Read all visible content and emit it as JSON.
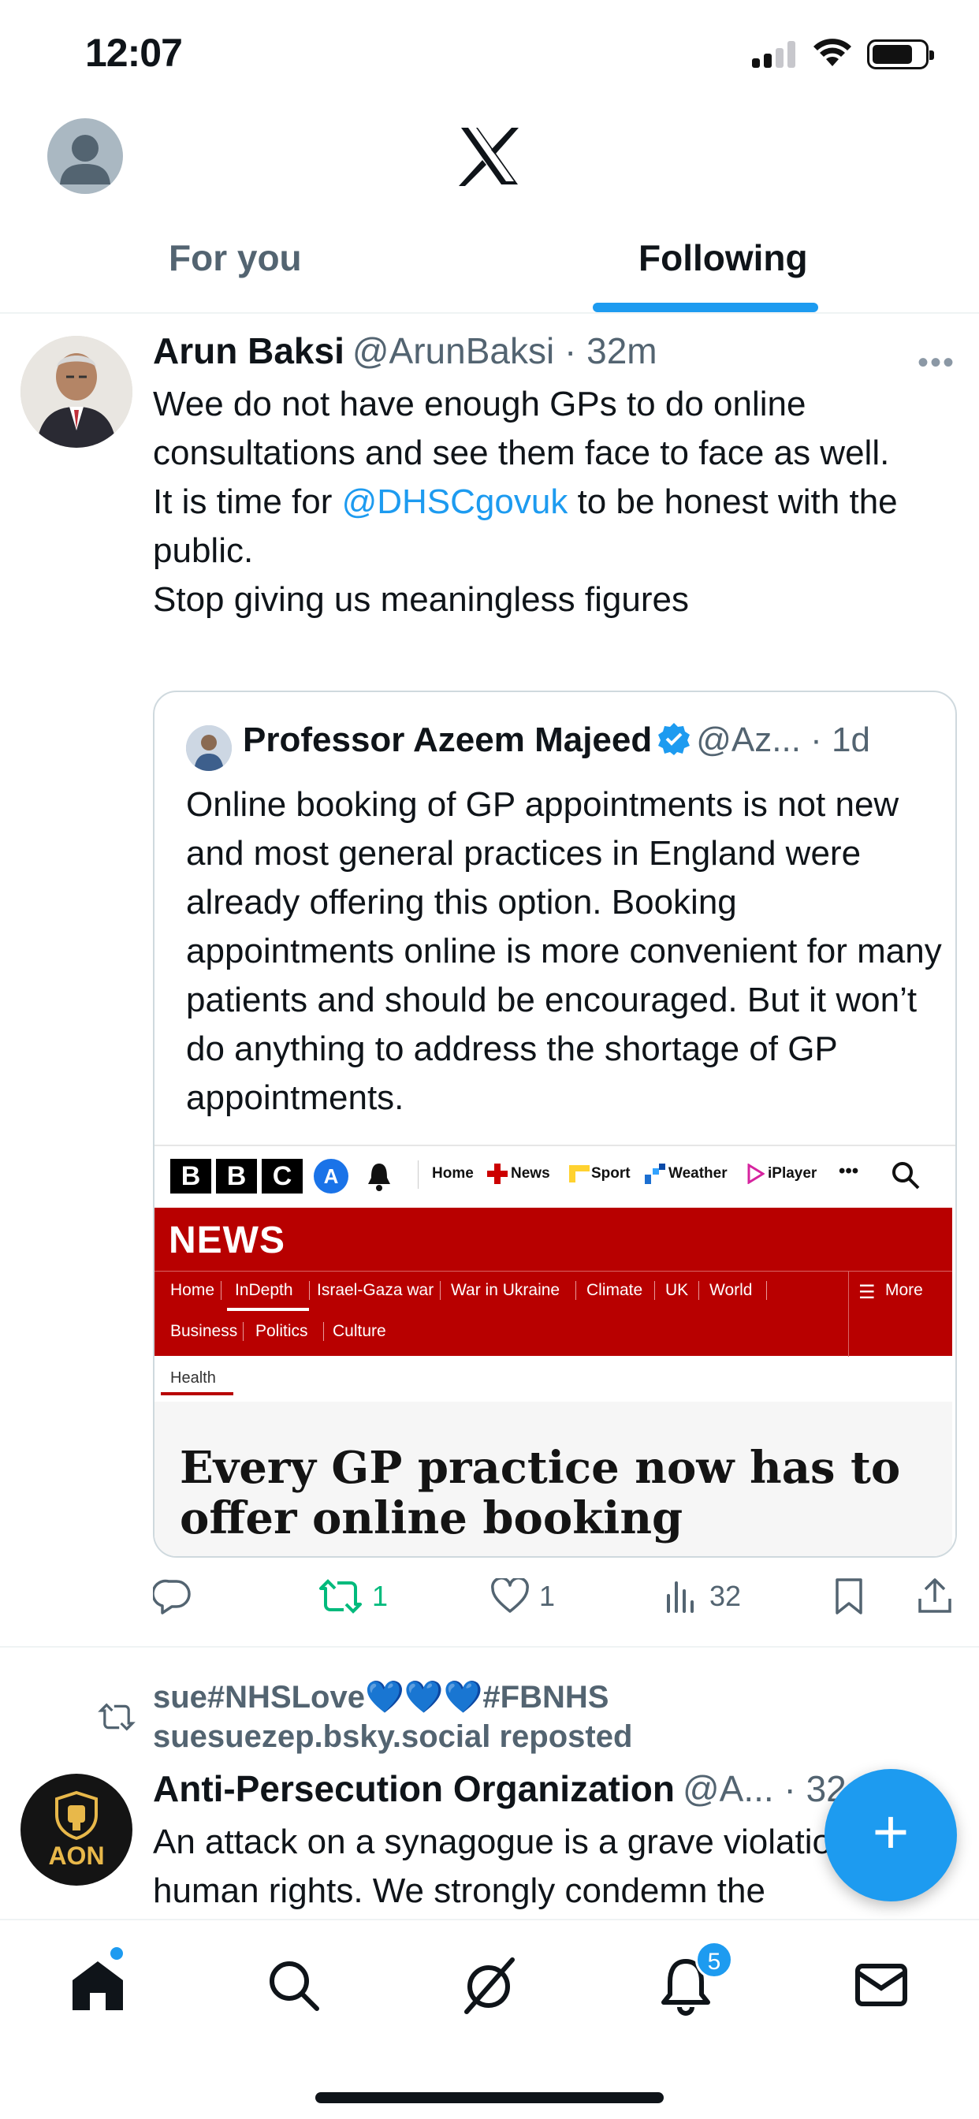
{
  "status_bar": {
    "time": "12:07"
  },
  "header": {
    "tabs": [
      {
        "label": "For you",
        "active": false
      },
      {
        "label": "Following",
        "active": true
      }
    ]
  },
  "tweet": {
    "author_name": "Arun Baksi",
    "handle": "@ArunBaksi",
    "time": "32m",
    "body": {
      "line1": "Wee do not have enough GPs to do online consultations and see them face to face as well.",
      "line2_pre": "It is time for ",
      "line2_mention": "@DHSCgovuk",
      "line2_post": " to be honest with the public.",
      "line3": "Stop giving us meaningless figures"
    },
    "quote": {
      "author_name": "Professor Azeem Majeed",
      "handle": "@Az...",
      "time": "1d",
      "body": "Online booking of GP appointments is not new and most general practices in England were already offering this option. Booking appointments online is more convenient for many patients and should be encouraged. But it won’t do anything to address the shortage of GP appointments.",
      "embed": {
        "logo_letters": [
          "B",
          "B",
          "C"
        ],
        "account_letter": "A",
        "top_nav": [
          "Home",
          "News",
          "Sport",
          "Weather",
          "iPlayer"
        ],
        "more_dots": "•••",
        "news_label": "NEWS",
        "sub_nav": [
          "Home",
          "InDepth",
          "Israel-Gaza war",
          "War in Ukraine",
          "Climate",
          "UK",
          "World",
          "Business",
          "Politics",
          "Culture"
        ],
        "more_label": "More",
        "section": "Health",
        "headline": "Every GP practice now has to offer online booking"
      }
    },
    "actions": {
      "replies": "",
      "reposts": "1",
      "likes": "1",
      "views": "32"
    }
  },
  "tweet2": {
    "reposted_by_name": "sue#NHSLove",
    "reposted_hearts": "💙💙💙",
    "reposted_by_tag": "#FBNHS",
    "reposted_line": "suesuezep.bsky.social reposted",
    "author_name": "Anti-Persecution Organization",
    "handle": "@A...",
    "time": "32",
    "avatar_text": "AON",
    "body": "An attack on a synagogue is a grave violation of human rights. We strongly condemn the"
  },
  "fab": {
    "label": "+"
  },
  "bottom_nav": {
    "notifications_badge": "5"
  },
  "colors": {
    "accent": "#1d9bf0",
    "repost_green": "#00ba7c",
    "bbc_red": "#b80000"
  }
}
